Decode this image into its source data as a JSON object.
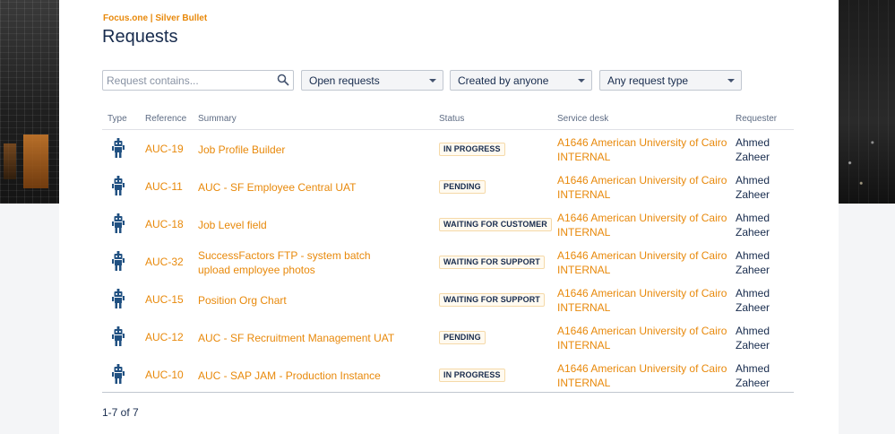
{
  "brand": "Focus.one | Silver Bullet",
  "page_title": "Requests",
  "filters": {
    "search_placeholder": "Request contains...",
    "status_filter": "Open requests",
    "creator_filter": "Created by anyone",
    "type_filter": "Any request type"
  },
  "table": {
    "headers": {
      "type": "Type",
      "reference": "Reference",
      "summary": "Summary",
      "status": "Status",
      "service_desk": "Service desk",
      "requester": "Requester"
    },
    "rows": [
      {
        "reference": "AUC-19",
        "summary": "Job Profile Builder",
        "status": "IN PROGRESS",
        "desk_line1": "A1646 American University of Cairo",
        "desk_line2": "INTERNAL",
        "req_line1": "Ahmed",
        "req_line2": "Zaheer"
      },
      {
        "reference": "AUC-11",
        "summary": "AUC - SF Employee Central UAT",
        "status": "PENDING",
        "desk_line1": "A1646 American University of Cairo",
        "desk_line2": "INTERNAL",
        "req_line1": "Ahmed",
        "req_line2": "Zaheer"
      },
      {
        "reference": "AUC-18",
        "summary": "Job Level field",
        "status": "WAITING FOR CUSTOMER",
        "desk_line1": "A1646 American University of Cairo",
        "desk_line2": "INTERNAL",
        "req_line1": "Ahmed",
        "req_line2": "Zaheer"
      },
      {
        "reference": "AUC-32",
        "summary": "SuccessFactors FTP - system batch upload employee photos",
        "status": "WAITING FOR SUPPORT",
        "desk_line1": "A1646 American University of Cairo",
        "desk_line2": "INTERNAL",
        "req_line1": "Ahmed",
        "req_line2": "Zaheer"
      },
      {
        "reference": "AUC-15",
        "summary": "Position Org Chart",
        "status": "WAITING FOR SUPPORT",
        "desk_line1": "A1646 American University of Cairo",
        "desk_line2": "INTERNAL",
        "req_line1": "Ahmed",
        "req_line2": "Zaheer"
      },
      {
        "reference": "AUC-12",
        "summary": "AUC - SF Recruitment Management UAT",
        "status": "PENDING",
        "desk_line1": "A1646 American University of Cairo",
        "desk_line2": "INTERNAL",
        "req_line1": "Ahmed",
        "req_line2": "Zaheer"
      },
      {
        "reference": "AUC-10",
        "summary": "AUC - SAP JAM - Production Instance",
        "status": "IN PROGRESS",
        "desk_line1": "A1646 American University of Cairo",
        "desk_line2": "INTERNAL",
        "req_line1": "Ahmed",
        "req_line2": "Zaheer"
      }
    ]
  },
  "pagination": "1-7 of 7",
  "colors": {
    "accent": "#e8890b",
    "text": "#172b4d",
    "icon": "#205081"
  },
  "icons": {
    "type": "robot-icon",
    "search": "search-icon",
    "dropdown": "chevron-down-icon"
  }
}
